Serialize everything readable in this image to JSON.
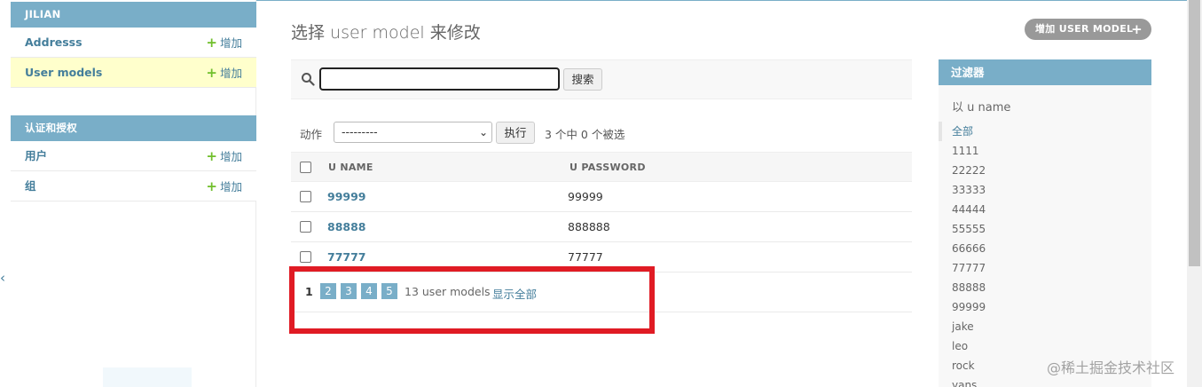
{
  "sidebar": {
    "collapse_glyph": "‹",
    "module1": {
      "caption": "JILIAN",
      "rows": [
        {
          "label": "Addresss",
          "add": "增加"
        },
        {
          "label": "User models",
          "add": "增加"
        }
      ]
    },
    "module2": {
      "caption": "认证和授权",
      "rows": [
        {
          "label": "用户",
          "add": "增加"
        },
        {
          "label": "组",
          "add": "增加"
        }
      ]
    }
  },
  "header": {
    "title": "选择 user model 来修改",
    "add_button": "增加 USER MODEL",
    "add_icon": "+"
  },
  "search": {
    "value": "",
    "button": "搜索"
  },
  "actions": {
    "label": "动作",
    "select_value": "---------",
    "go_button": "执行",
    "counter": "3 个中 0 个被选"
  },
  "table": {
    "headers": [
      "U NAME",
      "U PASSWORD"
    ],
    "rows": [
      {
        "name": "99999",
        "password": "99999"
      },
      {
        "name": "88888",
        "password": "888888"
      },
      {
        "name": "77777",
        "password": "77777"
      }
    ]
  },
  "paginator": {
    "current": "1",
    "pages": [
      "2",
      "3",
      "4",
      "5"
    ],
    "count": "13 user models",
    "show_all": "显示全部"
  },
  "filter": {
    "title": "过滤器",
    "by": "以 u name",
    "options": [
      "全部",
      "1111",
      "22222",
      "33333",
      "44444",
      "55555",
      "66666",
      "77777",
      "88888",
      "99999",
      "jake",
      "leo",
      "rock",
      "yans"
    ]
  },
  "watermark": "@稀土掘金技术社区",
  "colors": {
    "accent": "#79aec8",
    "link": "#447e9b",
    "add_green": "#70bf2b",
    "highlight_red": "#e01b24",
    "current_row": "#ffffcc"
  }
}
